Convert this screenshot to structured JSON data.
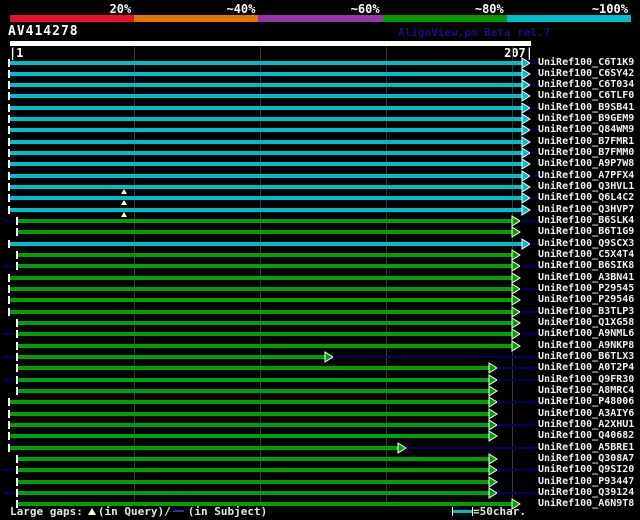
{
  "colors": {
    "cyan": "#00bccc",
    "green": "#00a000",
    "navy": "#000066",
    "gridline": "#3c3c20",
    "label_text": "#f0f0f0"
  },
  "scale": {
    "segments": [
      {
        "label": "20%",
        "color": "#e8112d"
      },
      {
        "label": "~40%",
        "color": "#dd7700"
      },
      {
        "label": "~60%",
        "color": "#9933aa"
      },
      {
        "label": "~80%",
        "color": "#009900"
      },
      {
        "label": "~100%",
        "color": "#00bccc"
      }
    ]
  },
  "header": {
    "query_name": "AV414278",
    "watermark": "AlignView.pm Beta rel.7"
  },
  "ruler": {
    "start_label": "|1",
    "end_label": "207|"
  },
  "legend": {
    "prefix": "Large gaps:",
    "query_text": "(in Query)/",
    "subject_text": "(in Subject)",
    "scale_text": "=50char."
  },
  "chart_data": {
    "type": "bar",
    "title": "AV414278",
    "xlim": [
      1,
      207
    ],
    "identity_buckets": [
      "20%",
      "~40%",
      "~60%",
      "~80%",
      "~100%"
    ],
    "series": [
      {
        "id": "UniRef100_C6T1K9",
        "identity": "~100%",
        "q1": 1,
        "q2": 207,
        "subj_left": false,
        "subj_right": true,
        "gap_at": null
      },
      {
        "id": "UniRef100_C6SY42",
        "identity": "~100%",
        "q1": 1,
        "q2": 207,
        "subj_left": false,
        "subj_right": false,
        "gap_at": null
      },
      {
        "id": "UniRef100_C6T034",
        "identity": "~100%",
        "q1": 1,
        "q2": 207,
        "subj_left": false,
        "subj_right": true,
        "gap_at": null
      },
      {
        "id": "UniRef100_C6TLF0",
        "identity": "~100%",
        "q1": 1,
        "q2": 207,
        "subj_left": false,
        "subj_right": false,
        "gap_at": null
      },
      {
        "id": "UniRef100_B9SB41",
        "identity": "~100%",
        "q1": 1,
        "q2": 207,
        "subj_left": false,
        "subj_right": true,
        "gap_at": null
      },
      {
        "id": "UniRef100_B9GEM9",
        "identity": "~100%",
        "q1": 1,
        "q2": 207,
        "subj_left": false,
        "subj_right": false,
        "gap_at": null
      },
      {
        "id": "UniRef100_Q84WM9",
        "identity": "~100%",
        "q1": 1,
        "q2": 207,
        "subj_left": false,
        "subj_right": true,
        "gap_at": null
      },
      {
        "id": "UniRef100_B7FMR1",
        "identity": "~100%",
        "q1": 1,
        "q2": 207,
        "subj_left": false,
        "subj_right": false,
        "gap_at": null
      },
      {
        "id": "UniRef100_B7FMM0",
        "identity": "~100%",
        "q1": 1,
        "q2": 207,
        "subj_left": false,
        "subj_right": true,
        "gap_at": null
      },
      {
        "id": "UniRef100_A9P7W8",
        "identity": "~100%",
        "q1": 1,
        "q2": 207,
        "subj_left": false,
        "subj_right": false,
        "gap_at": null
      },
      {
        "id": "UniRef100_A7PFX4",
        "identity": "~100%",
        "q1": 1,
        "q2": 207,
        "subj_left": false,
        "subj_right": true,
        "gap_at": null
      },
      {
        "id": "UniRef100_Q3HVL1",
        "identity": "~100%",
        "q1": 1,
        "q2": 207,
        "subj_left": false,
        "subj_right": false,
        "gap_at": 46
      },
      {
        "id": "UniRef100_Q6L4C2",
        "identity": "~100%",
        "q1": 1,
        "q2": 207,
        "subj_left": false,
        "subj_right": true,
        "gap_at": 46
      },
      {
        "id": "UniRef100_Q3HVP7",
        "identity": "~100%",
        "q1": 1,
        "q2": 207,
        "subj_left": false,
        "subj_right": false,
        "gap_at": 46
      },
      {
        "id": "UniRef100_B6SLK4",
        "identity": "~80%",
        "q1": 4,
        "q2": 203,
        "subj_left": true,
        "subj_right": true,
        "gap_at": null
      },
      {
        "id": "UniRef100_B6T1G9",
        "identity": "~80%",
        "q1": 4,
        "q2": 203,
        "subj_left": false,
        "subj_right": false,
        "gap_at": null
      },
      {
        "id": "UniRef100_Q9SCX3",
        "identity": "~100%",
        "q1": 1,
        "q2": 207,
        "subj_left": false,
        "subj_right": true,
        "gap_at": null
      },
      {
        "id": "UniRef100_C5X4T4",
        "identity": "~80%",
        "q1": 4,
        "q2": 203,
        "subj_left": false,
        "subj_right": false,
        "gap_at": null
      },
      {
        "id": "UniRef100_B6SIK8",
        "identity": "~80%",
        "q1": 4,
        "q2": 203,
        "subj_left": true,
        "subj_right": true,
        "gap_at": null
      },
      {
        "id": "UniRef100_A3BN41",
        "identity": "~80%",
        "q1": 1,
        "q2": 203,
        "subj_left": false,
        "subj_right": false,
        "gap_at": null
      },
      {
        "id": "UniRef100_P29545",
        "identity": "~80%",
        "q1": 1,
        "q2": 203,
        "subj_left": false,
        "subj_right": true,
        "gap_at": null
      },
      {
        "id": "UniRef100_P29546",
        "identity": "~80%",
        "q1": 1,
        "q2": 203,
        "subj_left": false,
        "subj_right": false,
        "gap_at": null
      },
      {
        "id": "UniRef100_B3TLP3",
        "identity": "~80%",
        "q1": 1,
        "q2": 203,
        "subj_left": false,
        "subj_right": true,
        "gap_at": null
      },
      {
        "id": "UniRef100_Q1XG58",
        "identity": "~80%",
        "q1": 4,
        "q2": 203,
        "subj_left": false,
        "subj_right": false,
        "gap_at": null
      },
      {
        "id": "UniRef100_A9NML6",
        "identity": "~80%",
        "q1": 4,
        "q2": 203,
        "subj_left": true,
        "subj_right": true,
        "gap_at": null
      },
      {
        "id": "UniRef100_A9NKP8",
        "identity": "~80%",
        "q1": 4,
        "q2": 203,
        "subj_left": false,
        "subj_right": false,
        "gap_at": null
      },
      {
        "id": "UniRef100_B6TLX3",
        "identity": "~80%",
        "q1": 4,
        "q2": 129,
        "subj_left": true,
        "subj_right": true,
        "gap_at": null
      },
      {
        "id": "UniRef100_A0T2P4",
        "identity": "~80%",
        "q1": 4,
        "q2": 194,
        "subj_left": false,
        "subj_right": true,
        "gap_at": null
      },
      {
        "id": "UniRef100_Q9FR30",
        "identity": "~80%",
        "q1": 4,
        "q2": 194,
        "subj_left": true,
        "subj_right": true,
        "gap_at": null
      },
      {
        "id": "UniRef100_A8MRC4",
        "identity": "~80%",
        "q1": 4,
        "q2": 194,
        "subj_left": false,
        "subj_right": false,
        "gap_at": null
      },
      {
        "id": "UniRef100_P48006",
        "identity": "~80%",
        "q1": 1,
        "q2": 194,
        "subj_left": false,
        "subj_right": true,
        "gap_at": null
      },
      {
        "id": "UniRef100_A3AIY6",
        "identity": "~80%",
        "q1": 1,
        "q2": 194,
        "subj_left": false,
        "subj_right": false,
        "gap_at": null
      },
      {
        "id": "UniRef100_A2XHU1",
        "identity": "~80%",
        "q1": 1,
        "q2": 194,
        "subj_left": false,
        "subj_right": true,
        "gap_at": null
      },
      {
        "id": "UniRef100_Q40682",
        "identity": "~80%",
        "q1": 1,
        "q2": 194,
        "subj_left": false,
        "subj_right": false,
        "gap_at": null
      },
      {
        "id": "UniRef100_A5BRE1",
        "identity": "~80%",
        "q1": 1,
        "q2": 158,
        "subj_left": false,
        "subj_right": true,
        "gap_at": null
      },
      {
        "id": "UniRef100_Q308A7",
        "identity": "~80%",
        "q1": 4,
        "q2": 194,
        "subj_left": false,
        "subj_right": false,
        "gap_at": null
      },
      {
        "id": "UniRef100_Q9SI20",
        "identity": "~80%",
        "q1": 4,
        "q2": 194,
        "subj_left": true,
        "subj_right": true,
        "gap_at": null
      },
      {
        "id": "UniRef100_P93447",
        "identity": "~80%",
        "q1": 4,
        "q2": 194,
        "subj_left": false,
        "subj_right": false,
        "gap_at": null
      },
      {
        "id": "UniRef100_Q39124",
        "identity": "~80%",
        "q1": 4,
        "q2": 194,
        "subj_left": true,
        "subj_right": true,
        "gap_at": null
      },
      {
        "id": "UniRef100_A6N9T8",
        "identity": "~80%",
        "q1": 4,
        "q2": 203,
        "subj_left": false,
        "subj_right": false,
        "gap_at": null
      }
    ]
  }
}
